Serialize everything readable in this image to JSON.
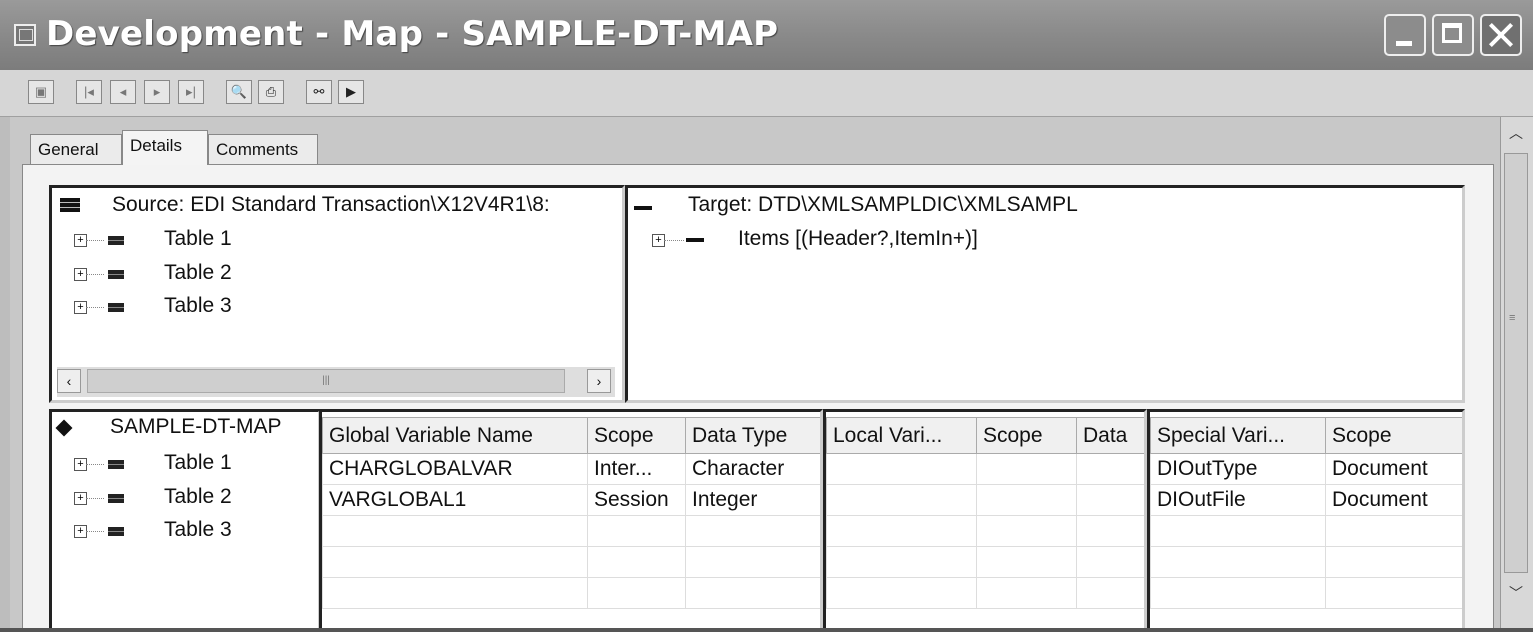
{
  "window": {
    "title": "Development - Map - SAMPLE-DT-MAP"
  },
  "toolbar": {
    "buttons": [
      "save-icon",
      "first-record-icon",
      "previous-record-icon",
      "next-record-icon",
      "last-record-icon",
      "print-preview-icon",
      "print-icon",
      "map-fields-icon",
      "run-map-icon"
    ]
  },
  "tabs": [
    {
      "label": "General",
      "active": false
    },
    {
      "label": "Details",
      "active": true
    },
    {
      "label": "Comments",
      "active": false
    }
  ],
  "source_tree": {
    "root": "Source: EDI Standard Transaction\\X12V4R1\\8:",
    "items": [
      "Table 1",
      "Table 2",
      "Table 3"
    ]
  },
  "target_tree": {
    "root": "Target: DTD\\XMLSAMPLDIC\\XMLSAMPL",
    "items": [
      "Items [(Header?,ItemIn+)]"
    ]
  },
  "map_tree": {
    "root": "SAMPLE-DT-MAP",
    "items": [
      "Table 1",
      "Table 2",
      "Table 3"
    ]
  },
  "global_vars": {
    "headers": [
      "Global Variable Name",
      "Scope",
      "Data Type"
    ],
    "rows": [
      [
        "CHARGLOBALVAR",
        "Inter...",
        "Character"
      ],
      [
        "VARGLOBAL1",
        "Session",
        "Integer"
      ]
    ]
  },
  "local_vars": {
    "headers": [
      "Local Vari...",
      "Scope",
      "Data"
    ],
    "rows": []
  },
  "special_vars": {
    "headers": [
      "Special Vari...",
      "Scope"
    ],
    "rows": [
      [
        "DIOutType",
        "Document"
      ],
      [
        "DIOutFile",
        "Document"
      ]
    ]
  }
}
